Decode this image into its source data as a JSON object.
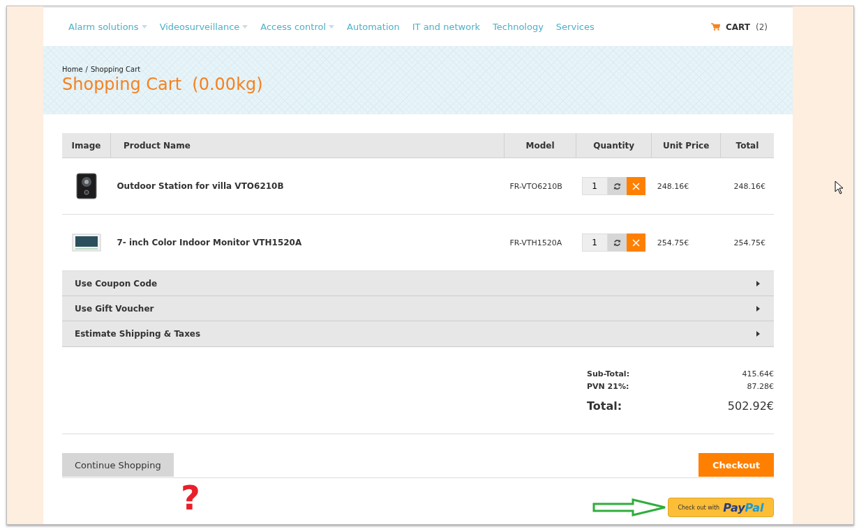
{
  "nav": {
    "items": [
      {
        "label": "Alarm solutions",
        "dropdown": true
      },
      {
        "label": "Videosurveillance",
        "dropdown": true
      },
      {
        "label": "Access control",
        "dropdown": true
      },
      {
        "label": "Automation",
        "dropdown": false
      },
      {
        "label": "IT and network",
        "dropdown": false
      },
      {
        "label": "Technology",
        "dropdown": false
      },
      {
        "label": "Services",
        "dropdown": false
      }
    ],
    "cart": {
      "label": "CART",
      "count": "(2)"
    }
  },
  "header": {
    "breadcrumb": [
      "Home",
      "Shopping Cart"
    ],
    "separator": "/",
    "title": "Shopping Cart  (0.00kg)"
  },
  "table": {
    "columns": [
      "Image",
      "Product Name",
      "Model",
      "Quantity",
      "Unit Price",
      "Total"
    ],
    "rows": [
      {
        "kind": "station",
        "name": "Outdoor Station for villa VTO6210B",
        "model": "FR-VTO6210B",
        "quantity": "1",
        "unit_price": "248.16€",
        "total": "248.16€"
      },
      {
        "kind": "monitor",
        "name": "7- inch Color Indoor Monitor VTH1520A",
        "model": "FR-VTH1520A",
        "quantity": "1",
        "unit_price": "254.75€",
        "total": "254.75€"
      }
    ]
  },
  "sections": [
    "Use Coupon Code",
    "Use Gift Voucher",
    "Estimate Shipping & Taxes"
  ],
  "totals": [
    {
      "label": "Sub-Total:",
      "value": "415.64€",
      "kind": "line"
    },
    {
      "label": "PVN 21%:",
      "value": "87.28€",
      "kind": "line"
    },
    {
      "label": "Total:",
      "value": "502.92€",
      "kind": "grand"
    }
  ],
  "buttons": {
    "continue": "Continue Shopping",
    "checkout": "Checkout"
  },
  "paypal": {
    "prefix": "Check out with",
    "pay": "Pay",
    "pal": "Pal"
  },
  "annotation": {
    "mark": "?"
  }
}
